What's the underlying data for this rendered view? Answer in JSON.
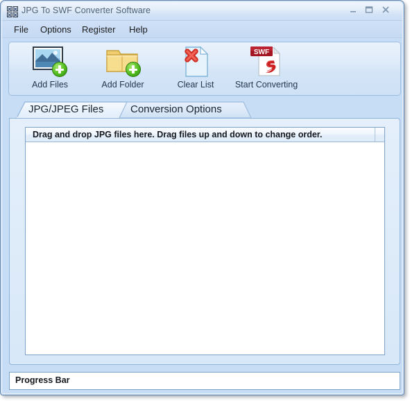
{
  "window": {
    "title": "JPG To SWF Converter Software",
    "app_icon": "app-icon",
    "controls": {
      "minimize": "minimize-icon",
      "maximize": "maximize-icon",
      "close": "close-icon"
    }
  },
  "menubar": {
    "items": [
      {
        "label": "File"
      },
      {
        "label": "Options"
      },
      {
        "label": "Register"
      },
      {
        "label": "Help"
      }
    ]
  },
  "toolbar": {
    "buttons": [
      {
        "label": "Add Files",
        "icon": "image-add-icon"
      },
      {
        "label": "Add Folder",
        "icon": "folder-add-icon"
      },
      {
        "label": "Clear List",
        "icon": "document-delete-icon"
      },
      {
        "label": "Start Converting",
        "icon": "swf-file-icon"
      }
    ],
    "swf_badge": "SWF"
  },
  "tabs": [
    {
      "label": "JPG/JPEG Files",
      "active": true
    },
    {
      "label": "Conversion Options",
      "active": false
    }
  ],
  "filelist": {
    "columns": [
      {
        "header": "Drag and drop JPG files here. Drag files up and down to change order."
      },
      {
        "header": ""
      }
    ],
    "rows": []
  },
  "statusbar": {
    "progress_label": "Progress Bar"
  },
  "colors": {
    "window_frame": "#6d8aad",
    "titlebar_top": "#eef5fc",
    "titlebar_bottom": "#cbdef5",
    "body_bg": "#c7dcf5",
    "panel_border": "#9cbcdf",
    "accent_green": "#52bc1f",
    "accent_red": "#cc1f1f",
    "swf_banner": "#a31621"
  }
}
